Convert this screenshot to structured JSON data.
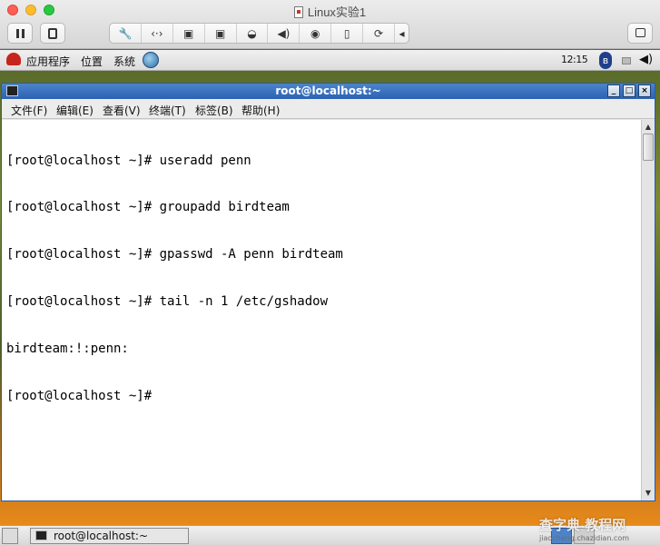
{
  "vm_window": {
    "title": "Linux实验1",
    "toolbar_icons": [
      "pause-icon",
      "snapshot-icon",
      "wrench-icon",
      "network-icon",
      "disk-icon",
      "disk-icon",
      "hdd-icon",
      "sound-icon",
      "cd-icon",
      "usb-icon",
      "refresh-icon",
      "arrow-left-icon",
      "fullscreen-icon"
    ]
  },
  "guest_panel": {
    "menu_apps": "应用程序",
    "menu_places": "位置",
    "menu_system": "系统",
    "clock": "12:15"
  },
  "terminal": {
    "title": "root@localhost:~",
    "menu": [
      "文件(F)",
      "编辑(E)",
      "查看(V)",
      "终端(T)",
      "标签(B)",
      "帮助(H)"
    ],
    "lines": [
      "[root@localhost ~]# useradd penn",
      "[root@localhost ~]# groupadd birdteam",
      "[root@localhost ~]# gpasswd -A penn birdteam",
      "[root@localhost ~]# tail -n 1 /etc/gshadow",
      "birdteam:!:penn:",
      "[root@localhost ~]#"
    ]
  },
  "taskbar": {
    "task_label": "root@localhost:~"
  },
  "watermark": {
    "line1": "查字典 教程网",
    "line2": "jiaocheng.chazidian.com"
  }
}
